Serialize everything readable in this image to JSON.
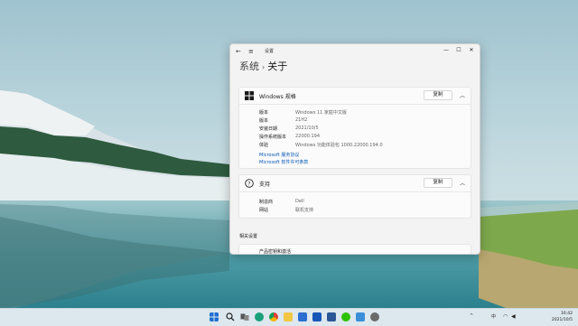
{
  "window": {
    "title": "设置",
    "controls": {
      "minimize": "—",
      "maximize": "☐",
      "close": "✕"
    },
    "back_icon": "←",
    "menu_icon": "≡"
  },
  "breadcrumb": {
    "parent": "系统",
    "separator": "›",
    "current": "关于"
  },
  "windows_spec": {
    "title": "Windows 规格",
    "copy_label": "复制",
    "rows": [
      {
        "label": "版本",
        "value": "Windows 11 家庭中文版"
      },
      {
        "label": "版本",
        "value": "21H2"
      },
      {
        "label": "安装日期",
        "value": "2021/10/5"
      },
      {
        "label": "操作系统版本",
        "value": "22000.194"
      },
      {
        "label": "体验",
        "value": "Windows 功能体验包 1000.22000.194.0"
      }
    ],
    "links": [
      "Microsoft 服务协议",
      "Microsoft 软件许可条款"
    ]
  },
  "support": {
    "title": "支持",
    "copy_label": "复制",
    "rows": [
      {
        "label": "制造商",
        "value": "Dell"
      },
      {
        "label": "网站",
        "value": "联机支持"
      }
    ]
  },
  "related": {
    "label": "相关设置",
    "first_item": "产品密钥和激活"
  },
  "taskbar": {
    "apps": [
      "windows-start",
      "search",
      "task-view",
      "edge",
      "chrome",
      "file-explorer",
      "store",
      "mail",
      "word",
      "wechat",
      "photos",
      "settings"
    ],
    "tray": [
      "^",
      "中",
      "wifi",
      "speaker"
    ],
    "time": "16:42",
    "date": "2021/10/5"
  },
  "colors": {
    "accent": "#0a5bb5",
    "window_bg": "#f3f3f3",
    "taskbar_bg": "#dde7ee"
  }
}
